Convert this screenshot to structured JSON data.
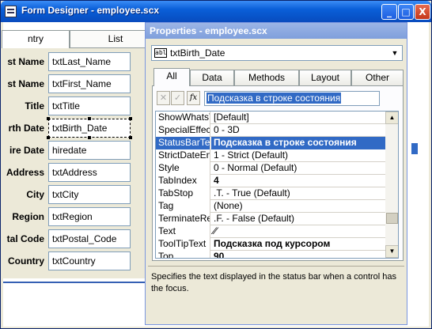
{
  "form_designer": {
    "title": "Form Designer - employee.scx",
    "window_buttons": {
      "minimize": "_",
      "maximize": "□",
      "close": "X"
    },
    "tabs": [
      "ntry",
      "List"
    ],
    "fields": [
      {
        "label": "st Name",
        "value": "txtLast_Name"
      },
      {
        "label": "st Name",
        "value": "txtFirst_Name"
      },
      {
        "label": "Title",
        "value": "txtTitle"
      },
      {
        "label": "rth Date",
        "value": "txtBirth_Date"
      },
      {
        "label": "ire Date",
        "value": "hiredate"
      },
      {
        "label": "Address",
        "value": "txtAddress"
      },
      {
        "label": "City",
        "value": "txtCity"
      },
      {
        "label": "Region",
        "value": "txtRegion"
      },
      {
        "label": "tal Code",
        "value": "txtPostal_Code"
      },
      {
        "label": "Country",
        "value": "txtCountry"
      }
    ]
  },
  "properties": {
    "title": "Properties - employee.scx",
    "object_icon": "abl",
    "object": "txtBirth_Date",
    "tabs": [
      "All",
      "Data",
      "Methods",
      "Layout",
      "Other"
    ],
    "active_tab": "All",
    "edit_buttons": {
      "cancel": "✕",
      "accept": "✓",
      "fx": "fx"
    },
    "edit_value": "Подсказка в строке состояния",
    "rows": [
      {
        "name": "ShowWhatsT",
        "value": "[Default]"
      },
      {
        "name": "SpecialEffect",
        "value": "0 - 3D"
      },
      {
        "name": "StatusBarTex",
        "value": "Подсказка в строке состояния"
      },
      {
        "name": "StrictDateEnt",
        "value": "1 - Strict (Default)"
      },
      {
        "name": "Style",
        "value": "0 - Normal (Default)"
      },
      {
        "name": "TabIndex",
        "value": "4"
      },
      {
        "name": "TabStop",
        "value": ".T. - True (Default)"
      },
      {
        "name": "Tag",
        "value": "(None)"
      },
      {
        "name": "TerminateRe",
        "value": ".F. - False (Default)"
      },
      {
        "name": "Text",
        "value": "⁄⁄"
      },
      {
        "name": "ToolTipText",
        "value": "Подсказка под курсором"
      },
      {
        "name": "Top",
        "value": "90"
      }
    ],
    "description": "Specifies the text displayed in the status bar when a control has the focus."
  },
  "colors": {
    "selection": "#316ac5",
    "titlebar": "#0a5fd8",
    "inactive_titlebar": "#8aa7e0"
  },
  "icons": [
    "app-icon",
    "minimize-icon",
    "maximize-icon",
    "close-icon",
    "textbox-icon",
    "chevron-down-icon",
    "cancel-icon",
    "check-icon",
    "fx-icon",
    "scroll-up-icon",
    "scroll-down-icon"
  ]
}
